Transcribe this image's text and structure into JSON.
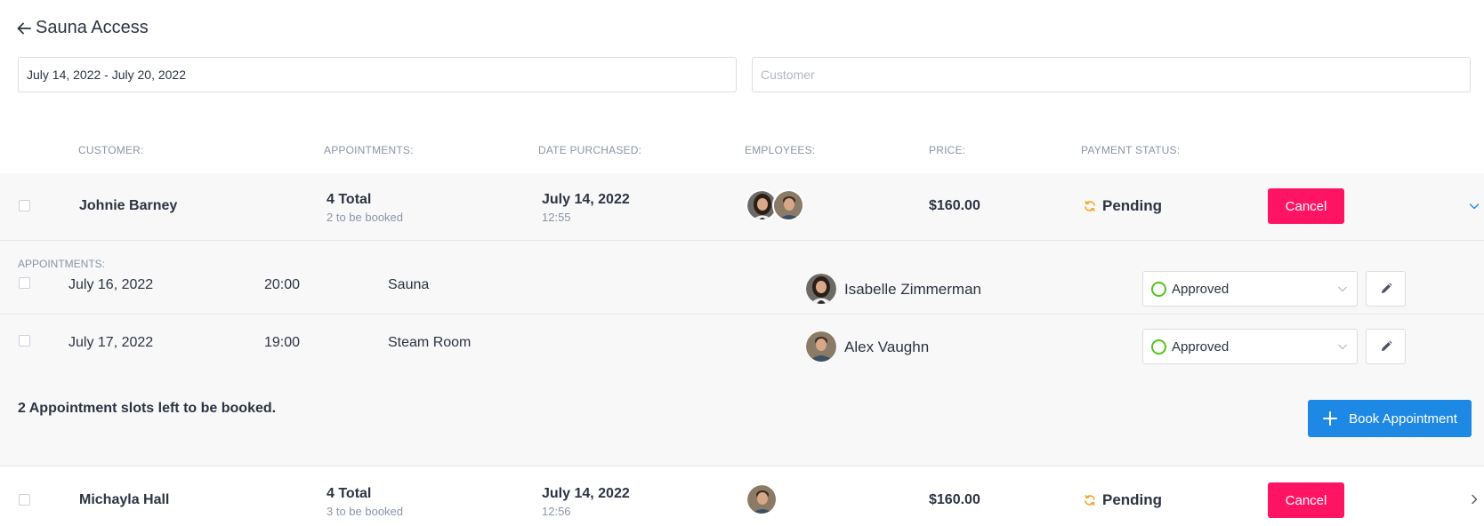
{
  "header": {
    "title": "Sauna Access",
    "back_icon": "arrow-left-icon"
  },
  "filters": {
    "date_range_value": "July 14, 2022 - July 20, 2022",
    "customer_placeholder": "Customer"
  },
  "columns": {
    "customer": "CUSTOMER:",
    "appointments": "APPOINTMENTS:",
    "date_purchased": "DATE PURCHASED:",
    "employees": "EMPLOYEES:",
    "price": "PRICE:",
    "payment_status": "PAYMENT STATUS:"
  },
  "colors": {
    "cancel": "#ff1464",
    "book": "#1e88e5",
    "pending": "#f5a623",
    "approved": "#52c41a"
  },
  "orders": [
    {
      "customer": "Johnie Barney",
      "appointments_total": "4 Total",
      "appointments_sub": "2 to be booked",
      "date": "July 14, 2022",
      "time": "12:55",
      "price": "$160.00",
      "status": "Pending",
      "cancel_label": "Cancel",
      "expanded": true,
      "appointments_label": "APPOINTMENTS:",
      "appointments": [
        {
          "date": "July 16, 2022",
          "time": "20:00",
          "service": "Sauna",
          "employee": "Isabelle Zimmerman",
          "status": "Approved"
        },
        {
          "date": "July 17, 2022",
          "time": "19:00",
          "service": "Steam Room",
          "employee": "Alex Vaughn",
          "status": "Approved"
        }
      ],
      "slots_left": "2 Appointment slots left to be booked.",
      "book_label": "Book Appointment"
    },
    {
      "customer": "Michayla Hall",
      "appointments_total": "4 Total",
      "appointments_sub": "3 to be booked",
      "date": "July 14, 2022",
      "time": "12:56",
      "price": "$160.00",
      "status": "Pending",
      "cancel_label": "Cancel",
      "expanded": false
    }
  ]
}
